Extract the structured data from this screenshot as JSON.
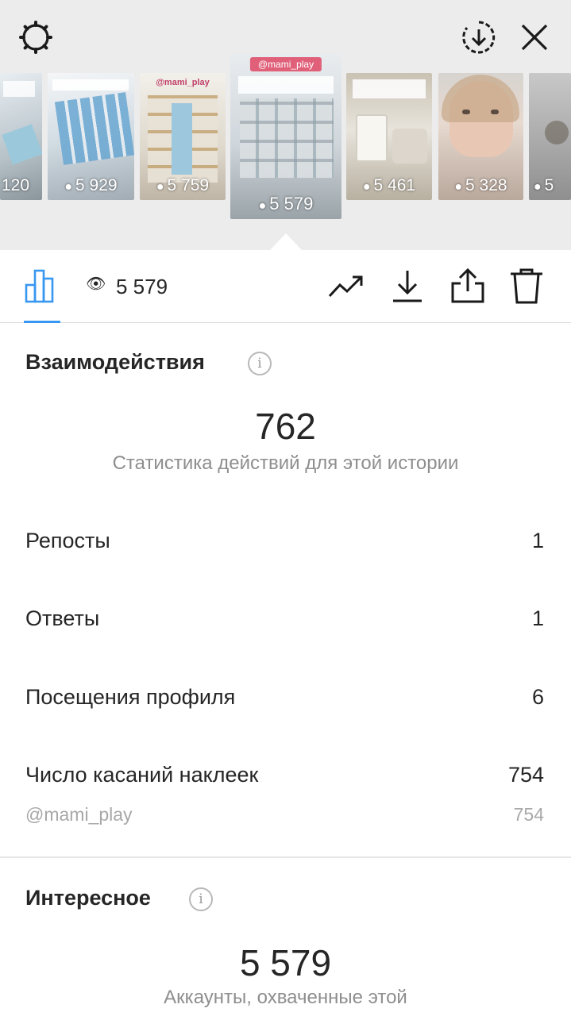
{
  "stories": [
    {
      "views": "120"
    },
    {
      "views": "5 929"
    },
    {
      "views": "5 759",
      "tag": "@mami_play"
    },
    {
      "views": "5 579",
      "tag": "@mami_play"
    },
    {
      "views": "5 461"
    },
    {
      "views": "5 328"
    },
    {
      "views": "5"
    }
  ],
  "toolbar": {
    "view_count": "5 579"
  },
  "interactions": {
    "title": "Взаимодействия",
    "total": "762",
    "subtitle": "Статистика действий для этой истории",
    "rows": [
      {
        "label": "Репосты",
        "value": "1"
      },
      {
        "label": "Ответы",
        "value": "1"
      },
      {
        "label": "Посещения профиля",
        "value": "6"
      },
      {
        "label": "Число касаний наклеек",
        "value": "754"
      }
    ],
    "sticker": {
      "label": "@mami_play",
      "value": "754"
    }
  },
  "discovery": {
    "title": "Интересное",
    "total": "5 579",
    "subtitle": "Аккаунты, охваченные этой"
  },
  "colors": {
    "accent": "#3897f0",
    "muted": "#8e8e8e",
    "tag": "#e0607a"
  }
}
